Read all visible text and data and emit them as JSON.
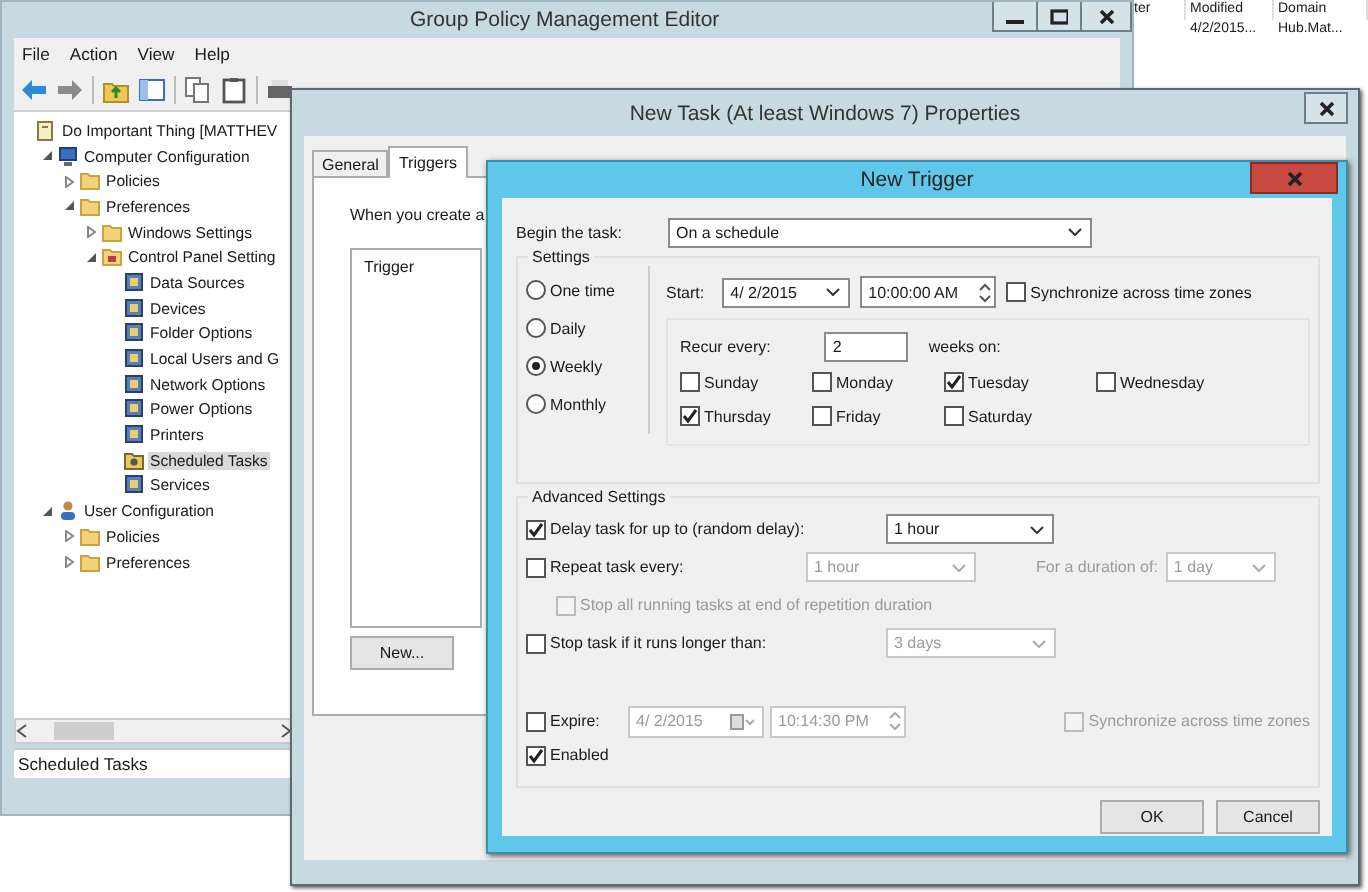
{
  "background_table": {
    "columns": [
      "ter",
      "Modified",
      "Domain"
    ],
    "row": [
      "4/2/2015...",
      "Hub.Mat..."
    ]
  },
  "editor": {
    "title": "Group Policy Management Editor",
    "menu": [
      "File",
      "Action",
      "View",
      "Help"
    ],
    "tree": [
      {
        "label": "Do Important Thing [MATTHEV",
        "kind": "root",
        "selected": false,
        "children": [
          {
            "label": "Computer Configuration",
            "kind": "computer",
            "expanded": true,
            "selected": false,
            "children": [
              {
                "label": "Policies",
                "kind": "folder",
                "expanded": false,
                "selected": false
              },
              {
                "label": "Preferences",
                "kind": "folder",
                "expanded": true,
                "selected": false,
                "children": [
                  {
                    "label": "Windows Settings",
                    "kind": "folder",
                    "expanded": false,
                    "selected": false
                  },
                  {
                    "label": "Control Panel Setting",
                    "kind": "panel",
                    "expanded": true,
                    "selected": false,
                    "children": [
                      {
                        "label": "Data Sources",
                        "kind": "item",
                        "selected": false
                      },
                      {
                        "label": "Devices",
                        "kind": "item",
                        "selected": false
                      },
                      {
                        "label": "Folder Options",
                        "kind": "item",
                        "selected": false
                      },
                      {
                        "label": "Local Users and G",
                        "kind": "item",
                        "selected": false
                      },
                      {
                        "label": "Network Options",
                        "kind": "item",
                        "selected": false
                      },
                      {
                        "label": "Power Options",
                        "kind": "item",
                        "selected": false
                      },
                      {
                        "label": "Printers",
                        "kind": "item",
                        "selected": false
                      },
                      {
                        "label": "Scheduled Tasks",
                        "kind": "task",
                        "selected": true
                      },
                      {
                        "label": "Services",
                        "kind": "item",
                        "selected": false
                      }
                    ]
                  }
                ]
              }
            ]
          },
          {
            "label": "User Configuration",
            "kind": "user",
            "expanded": true,
            "selected": false,
            "children": [
              {
                "label": "Policies",
                "kind": "folder",
                "expanded": false,
                "selected": false
              },
              {
                "label": "Preferences",
                "kind": "folder",
                "expanded": false,
                "selected": false
              }
            ]
          }
        ]
      }
    ],
    "status_bar": "Scheduled Tasks"
  },
  "properties": {
    "title": "New Task (At least Windows 7) Properties",
    "tabs": [
      {
        "label": "General",
        "selected": false
      },
      {
        "label": "Triggers",
        "selected": true
      }
    ],
    "intro": "When you create a",
    "list_header": "Trigger",
    "new_button": "New..."
  },
  "trigger": {
    "title": "New Trigger",
    "begin_label": "Begin the task:",
    "begin_value": "On a schedule",
    "settings_label": "Settings",
    "schedules": [
      {
        "label": "One time",
        "selected": false
      },
      {
        "label": "Daily",
        "selected": false
      },
      {
        "label": "Weekly",
        "selected": true
      },
      {
        "label": "Monthly",
        "selected": false
      }
    ],
    "start_label": "Start:",
    "start_date": "4/ 2/2015",
    "start_time": "10:00:00 AM",
    "sync": {
      "label": "Synchronize across time zones",
      "checked": false
    },
    "recur_label": "Recur every:",
    "recur_value": "2",
    "recur_suffix": "weeks on:",
    "days": [
      {
        "label": "Sunday",
        "checked": false
      },
      {
        "label": "Monday",
        "checked": false
      },
      {
        "label": "Tuesday",
        "checked": true
      },
      {
        "label": "Wednesday",
        "checked": false
      },
      {
        "label": "Thursday",
        "checked": true
      },
      {
        "label": "Friday",
        "checked": false
      },
      {
        "label": "Saturday",
        "checked": false
      }
    ],
    "advanced_label": "Advanced Settings",
    "delay": {
      "label": "Delay task for up to (random delay):",
      "checked": true,
      "value": "1 hour",
      "disabled": false
    },
    "repeat": {
      "label": "Repeat task every:",
      "checked": false,
      "value": "1 hour",
      "disabled": true,
      "duration_label": "For a duration of:",
      "duration_value": "1 day"
    },
    "stop_all": {
      "label": "Stop all running tasks at end of repetition duration",
      "checked": false,
      "disabled": true
    },
    "stop_longer": {
      "label": "Stop task if it runs longer than:",
      "checked": false,
      "value": "3 days",
      "disabled": true
    },
    "expire": {
      "label": "Expire:",
      "checked": false,
      "date": "4/ 2/2015",
      "time": "10:14:30 PM",
      "disabled": true
    },
    "expire_sync": {
      "label": "Synchronize across time zones",
      "checked": false,
      "disabled": true
    },
    "enabled": {
      "label": "Enabled",
      "checked": true
    },
    "buttons": [
      "OK",
      "Cancel"
    ]
  }
}
